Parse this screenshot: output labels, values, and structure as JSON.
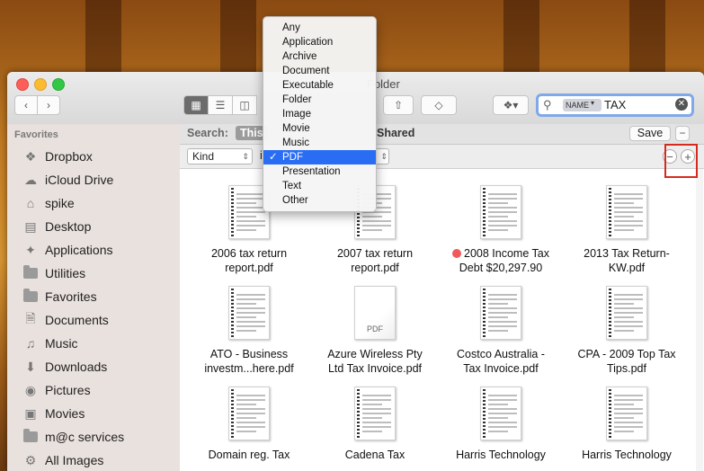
{
  "window": {
    "title": "Folder"
  },
  "toolbar": {
    "search_token": "NAME",
    "search_text": "TAX"
  },
  "sidebar": {
    "heading": "Favorites",
    "items": [
      {
        "label": "Dropbox",
        "icon": "dropbox-icon"
      },
      {
        "label": "iCloud Drive",
        "icon": "cloud-icon"
      },
      {
        "label": "spike",
        "icon": "home-icon"
      },
      {
        "label": "Desktop",
        "icon": "desktop-icon"
      },
      {
        "label": "Applications",
        "icon": "applications-icon"
      },
      {
        "label": "Utilities",
        "icon": "folder-icon"
      },
      {
        "label": "Favorites",
        "icon": "folder-icon"
      },
      {
        "label": "Documents",
        "icon": "documents-icon"
      },
      {
        "label": "Music",
        "icon": "music-icon"
      },
      {
        "label": "Downloads",
        "icon": "downloads-icon"
      },
      {
        "label": "Pictures",
        "icon": "camera-icon"
      },
      {
        "label": "Movies",
        "icon": "film-icon"
      },
      {
        "label": "m@c services",
        "icon": "folder-icon"
      },
      {
        "label": "All Images",
        "icon": "gear-icon"
      }
    ]
  },
  "searchbar": {
    "label": "Search:",
    "scope_this": "This",
    "scope_shared": "Shared",
    "save_label": "Save"
  },
  "criteria": {
    "attribute": "Kind",
    "operator": "i"
  },
  "kind_menu": {
    "items": [
      "Any",
      "Application",
      "Archive",
      "Document",
      "Executable",
      "Folder",
      "Image",
      "Movie",
      "Music",
      "PDF",
      "Presentation",
      "Text",
      "Other"
    ],
    "selected": "PDF",
    "check": "✓"
  },
  "files": [
    {
      "line1": "2006 tax return",
      "line2": "report.pdf",
      "tag": ""
    },
    {
      "line1": "2007 tax return",
      "line2": "report.pdf",
      "tag": ""
    },
    {
      "line1": "2008 Income Tax",
      "line2": "Debt $20,297.90",
      "tag": "red"
    },
    {
      "line1": "2013 Tax Return-",
      "line2": "KW.pdf",
      "tag": ""
    },
    {
      "line1": "ATO - Business",
      "line2": "investm...here.pdf",
      "tag": ""
    },
    {
      "line1": "Azure Wireless Pty",
      "line2": "Ltd Tax Invoice.pdf",
      "tag": "",
      "thumb_label": "PDF"
    },
    {
      "line1": "Costco Australia -",
      "line2": "Tax Invoice.pdf",
      "tag": ""
    },
    {
      "line1": "CPA - 2009 Top Tax",
      "line2": "Tips.pdf",
      "tag": ""
    },
    {
      "line1": "Domain reg. Tax",
      "line2": "",
      "tag": ""
    },
    {
      "line1": "Cadena Tax",
      "line2": "",
      "tag": ""
    },
    {
      "line1": "Harris Technology",
      "line2": "",
      "tag": ""
    },
    {
      "line1": "Harris Technology",
      "line2": "",
      "tag": ""
    }
  ],
  "colors": {
    "accent": "#2a6df5",
    "highlight_box": "#d52b1e",
    "tag_red": "#f05a5a"
  }
}
